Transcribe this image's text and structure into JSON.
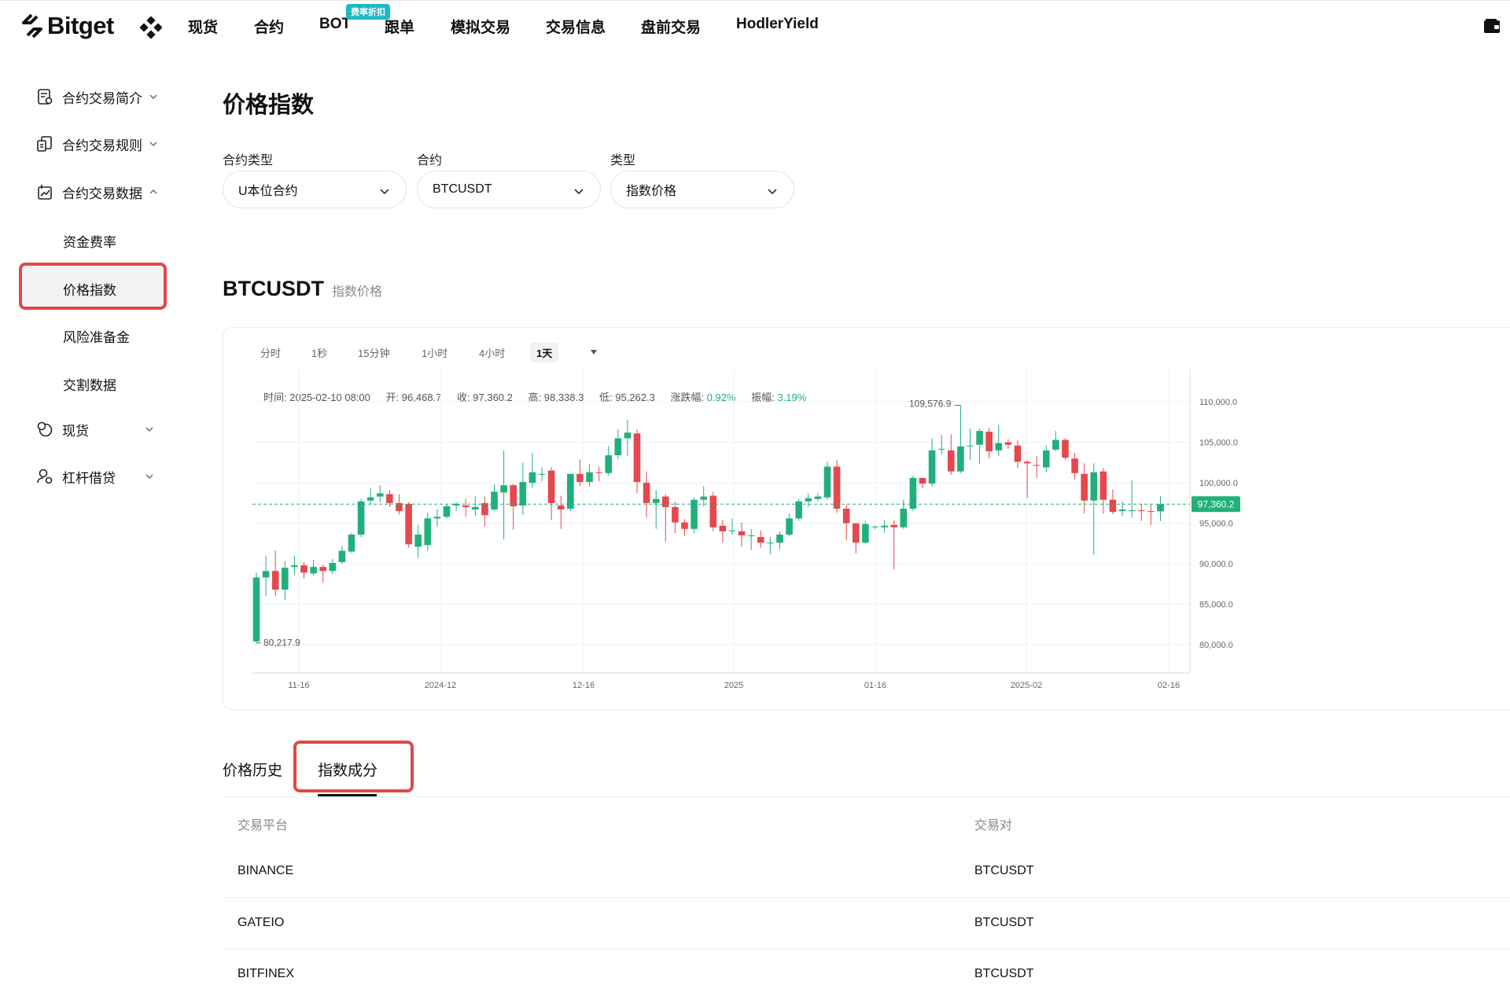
{
  "brand": {
    "name": "Bitget",
    "accent": "#1fb8c6",
    "highlight": "#e04848"
  },
  "nav": {
    "items": [
      "现货",
      "合约",
      "BOT",
      "跟单",
      "模拟交易",
      "交易信息",
      "盘前交易",
      "HodlerYield"
    ],
    "badge": "费率折扣"
  },
  "sidebar": {
    "items": [
      {
        "label": "合约交易简介",
        "icon": "document-icon",
        "expanded": false
      },
      {
        "label": "合约交易规则",
        "icon": "rules-icon",
        "expanded": false
      },
      {
        "label": "合约交易数据",
        "icon": "chart-icon",
        "expanded": true
      },
      {
        "label": "现货",
        "icon": "spot-icon",
        "expanded": false
      },
      {
        "label": "杠杆借贷",
        "icon": "margin-icon",
        "expanded": false
      }
    ],
    "sub_items": [
      "资金费率",
      "价格指数",
      "风险准备金",
      "交割数据"
    ],
    "active": "价格指数"
  },
  "page": {
    "title": "价格指数",
    "filters": [
      {
        "label": "合约类型",
        "value": "U本位合约"
      },
      {
        "label": "合约",
        "value": "BTCUSDT"
      },
      {
        "label": "类型",
        "value": "指数价格"
      }
    ]
  },
  "chart_header": {
    "symbol": "BTCUSDT",
    "subtitle": "指数价格"
  },
  "timeframes": {
    "items": [
      "分时",
      "1秒",
      "15分钟",
      "1小时",
      "4小时",
      "1天"
    ],
    "active": "1天"
  },
  "ohlc": {
    "time_label": "时间:",
    "time": "2025-02-10 08:00",
    "open_label": "开:",
    "open": "96,468.7",
    "close_label": "收:",
    "close": "97,360.2",
    "high_label": "高:",
    "high": "98,338.3",
    "low_label": "低:",
    "low": "95,262.3",
    "change_label": "涨跌幅:",
    "change": "0.92%",
    "amp_label": "振幅:",
    "amp": "3.19%"
  },
  "chart_data": {
    "type": "candlestick",
    "colors": {
      "up": "#21b07a",
      "down": "#e5484d"
    },
    "y_ticks": [
      "110,000.0",
      "105,000.0",
      "100,000.0",
      "95,000.0",
      "90,000.0",
      "85,000.0",
      "80,000.0"
    ],
    "y_tick_values": [
      110000,
      105000,
      100000,
      95000,
      90000,
      85000,
      80000
    ],
    "x_ticks": [
      "11-16",
      "2024-12",
      "12-16",
      "2025",
      "01-16",
      "2025-02",
      "02-16"
    ],
    "max_label": "109,576.9",
    "min_label": "80,217.9",
    "last_price": "97,360.2",
    "grid": true,
    "candles": [
      [
        80400,
        88300,
        80217,
        88900
      ],
      [
        88300,
        89100,
        86000,
        91000
      ],
      [
        89100,
        86800,
        86000,
        91600
      ],
      [
        86800,
        89500,
        85500,
        90300
      ],
      [
        89600,
        89800,
        88700,
        91000
      ],
      [
        89800,
        88900,
        88200,
        90200
      ],
      [
        88800,
        89600,
        88500,
        90500
      ],
      [
        89600,
        89100,
        87700,
        89900
      ],
      [
        89100,
        90100,
        88700,
        90600
      ],
      [
        90200,
        91600,
        90000,
        92200
      ],
      [
        91500,
        93600,
        91300,
        93800
      ],
      [
        93600,
        97700,
        93300,
        98000
      ],
      [
        97800,
        98200,
        97300,
        99300
      ],
      [
        98300,
        98700,
        97600,
        99700
      ],
      [
        98600,
        97500,
        97000,
        99100
      ],
      [
        97500,
        96500,
        96100,
        98600
      ],
      [
        97400,
        92400,
        92000,
        97600
      ],
      [
        92100,
        93600,
        90700,
        94800
      ],
      [
        92300,
        95600,
        91600,
        96300
      ],
      [
        95600,
        95800,
        94600,
        96700
      ],
      [
        95800,
        97100,
        95600,
        97400
      ],
      [
        97200,
        97400,
        96500,
        97600
      ],
      [
        97200,
        97000,
        95800,
        98000
      ],
      [
        96700,
        97000,
        95900,
        98400
      ],
      [
        97500,
        96000,
        94600,
        98300
      ],
      [
        96700,
        98900,
        96500,
        99800
      ],
      [
        98800,
        99700,
        93000,
        104000
      ],
      [
        99700,
        97100,
        94200,
        99900
      ],
      [
        97200,
        100100,
        96000,
        102500
      ],
      [
        100000,
        101300,
        99400,
        103700
      ],
      [
        101100,
        101100,
        100200,
        101900
      ],
      [
        101500,
        97500,
        95400,
        101900
      ],
      [
        97200,
        96700,
        94300,
        98400
      ],
      [
        96800,
        101100,
        96500,
        101100
      ],
      [
        101100,
        100100,
        99600,
        102900
      ],
      [
        100100,
        101300,
        99500,
        102300
      ],
      [
        101300,
        101200,
        100200,
        102000
      ],
      [
        101200,
        103400,
        100900,
        104500
      ],
      [
        103400,
        105500,
        102900,
        106600
      ],
      [
        105500,
        106200,
        103300,
        107800
      ],
      [
        106100,
        100100,
        98700,
        106600
      ],
      [
        100000,
        97500,
        95700,
        101400
      ],
      [
        97500,
        98000,
        94300,
        99100
      ],
      [
        98300,
        97000,
        92700,
        98600
      ],
      [
        97000,
        95100,
        93800,
        97700
      ],
      [
        95100,
        94300,
        93400,
        95500
      ],
      [
        94300,
        97900,
        93800,
        98200
      ],
      [
        97900,
        98300,
        97100,
        99600
      ],
      [
        98400,
        94500,
        94000,
        98900
      ],
      [
        94700,
        94000,
        92600,
        95400
      ],
      [
        94000,
        94100,
        93600,
        95600
      ],
      [
        94000,
        93500,
        92100,
        95100
      ],
      [
        93500,
        93500,
        91700,
        94300
      ],
      [
        93300,
        92600,
        92000,
        94100
      ],
      [
        92600,
        92600,
        91200,
        93300
      ],
      [
        92600,
        93600,
        91800,
        94000
      ],
      [
        93600,
        95600,
        93400,
        96200
      ],
      [
        95600,
        97700,
        95300,
        98000
      ],
      [
        97700,
        98100,
        97000,
        98700
      ],
      [
        98000,
        98300,
        97700,
        98700
      ],
      [
        98200,
        102000,
        97900,
        102600
      ],
      [
        102000,
        96800,
        96300,
        102800
      ],
      [
        96800,
        95000,
        92900,
        97300
      ],
      [
        95000,
        92600,
        91300,
        95000
      ],
      [
        92600,
        94900,
        92500,
        95300
      ],
      [
        94600,
        94600,
        94300,
        94700
      ],
      [
        94500,
        94700,
        93800,
        95400
      ],
      [
        94800,
        94500,
        89300,
        95400
      ],
      [
        94500,
        96800,
        94300,
        97900
      ],
      [
        96800,
        100600,
        96500,
        100900
      ],
      [
        100600,
        99900,
        99300,
        100500
      ],
      [
        99900,
        104000,
        99500,
        105500
      ],
      [
        104100,
        104200,
        103500,
        105900
      ],
      [
        104000,
        101400,
        101000,
        106000
      ],
      [
        101400,
        104500,
        101200,
        109577
      ],
      [
        104500,
        104600,
        102800,
        106700
      ],
      [
        104700,
        106400,
        102300,
        106700
      ],
      [
        106300,
        103900,
        103000,
        106800
      ],
      [
        104000,
        104900,
        103300,
        107100
      ],
      [
        105000,
        104700,
        104200,
        105400
      ],
      [
        104600,
        102600,
        101800,
        105300
      ],
      [
        102600,
        102400,
        98100,
        102800
      ],
      [
        102200,
        102100,
        100600,
        103300
      ],
      [
        101900,
        104000,
        101300,
        104600
      ],
      [
        104100,
        105300,
        103900,
        106400
      ],
      [
        105300,
        103100,
        102800,
        105500
      ],
      [
        103000,
        101200,
        100400,
        103700
      ],
      [
        101100,
        97800,
        96200,
        102400
      ],
      [
        97800,
        101300,
        91100,
        102400
      ],
      [
        101400,
        97900,
        96200,
        101800
      ],
      [
        97900,
        96400,
        96100,
        99200
      ],
      [
        96500,
        96700,
        95900,
        97700
      ],
      [
        96600,
        96600,
        95700,
        100300
      ],
      [
        96600,
        96500,
        95300,
        97400
      ],
      [
        96500,
        96400,
        94800,
        97300
      ],
      [
        96468,
        97360,
        95262,
        98338
      ]
    ]
  },
  "tabs": {
    "items": [
      "价格历史",
      "指数成分"
    ],
    "active": "指数成分"
  },
  "table": {
    "headers": [
      "交易平台",
      "交易对"
    ],
    "rows": [
      {
        "platform": "BINANCE",
        "pair": "BTCUSDT"
      },
      {
        "platform": "GATEIO",
        "pair": "BTCUSDT"
      },
      {
        "platform": "BITFINEX",
        "pair": "BTCUSDT"
      }
    ]
  }
}
